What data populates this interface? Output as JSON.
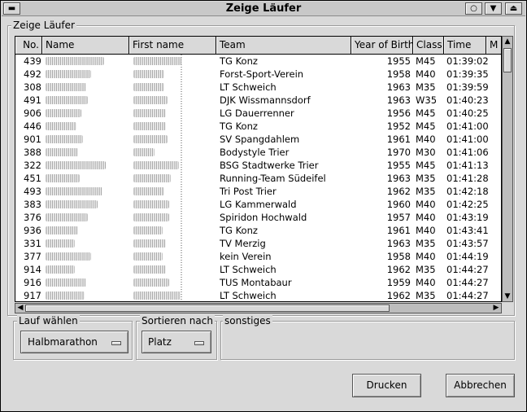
{
  "window": {
    "title": "Zeige Läufer",
    "controls": [
      "restore-icon",
      "minimize-icon",
      "maximize-icon"
    ]
  },
  "runners_group": {
    "legend": "Zeige Läufer"
  },
  "table": {
    "columns": [
      "No.",
      "Name",
      "First name",
      "Team",
      "Year of Birth",
      "Class",
      "Time",
      "M"
    ],
    "rows": [
      {
        "no": "439",
        "team": "TG Konz",
        "year": "1955",
        "class": "M45",
        "time": "01:39:02"
      },
      {
        "no": "492",
        "team": "Forst-Sport-Verein",
        "year": "1958",
        "class": "M40",
        "time": "01:39:35"
      },
      {
        "no": "308",
        "team": "LT Schweich",
        "year": "1963",
        "class": "M35",
        "time": "01:39:59"
      },
      {
        "no": "491",
        "team": "DJK Wissmannsdorf",
        "year": "1963",
        "class": "W35",
        "time": "01:40:23"
      },
      {
        "no": "906",
        "team": "LG Dauerrenner",
        "year": "1956",
        "class": "M45",
        "time": "01:40:25"
      },
      {
        "no": "446",
        "team": "TG Konz",
        "year": "1952",
        "class": "M45",
        "time": "01:41:00"
      },
      {
        "no": "901",
        "team": "SV Spangdahlem",
        "year": "1961",
        "class": "M40",
        "time": "01:41:00"
      },
      {
        "no": "388",
        "team": "Bodystyle Trier",
        "year": "1970",
        "class": "M30",
        "time": "01:41:06"
      },
      {
        "no": "322",
        "team": "BSG Stadtwerke Trier",
        "year": "1955",
        "class": "M45",
        "time": "01:41:13"
      },
      {
        "no": "451",
        "team": "Running-Team Südeifel",
        "year": "1963",
        "class": "M35",
        "time": "01:41:28"
      },
      {
        "no": "493",
        "team": "Tri Post Trier",
        "year": "1962",
        "class": "M35",
        "time": "01:42:18"
      },
      {
        "no": "383",
        "team": "LG Kammerwald",
        "year": "1960",
        "class": "M40",
        "time": "01:42:25"
      },
      {
        "no": "376",
        "team": "Spiridon Hochwald",
        "year": "1957",
        "class": "M40",
        "time": "01:43:19"
      },
      {
        "no": "936",
        "team": "TG Konz",
        "year": "1961",
        "class": "M40",
        "time": "01:43:41"
      },
      {
        "no": "331",
        "team": "TV Merzig",
        "year": "1963",
        "class": "M35",
        "time": "01:43:57"
      },
      {
        "no": "377",
        "team": "kein Verein",
        "year": "1958",
        "class": "M40",
        "time": "01:44:19"
      },
      {
        "no": "914",
        "team": "LT Schweich",
        "year": "1962",
        "class": "M35",
        "time": "01:44:27"
      },
      {
        "no": "916",
        "team": "TUS Montabaur",
        "year": "1959",
        "class": "M40",
        "time": "01:44:27"
      },
      {
        "no": "917",
        "team": "LT Schweich",
        "year": "1962",
        "class": "M35",
        "time": "01:44:27"
      }
    ]
  },
  "race_group": {
    "legend": "Lauf wählen",
    "selected": "Halbmarathon"
  },
  "sort_group": {
    "legend": "Sortieren nach",
    "selected": "Platz"
  },
  "misc_group": {
    "legend": "sonstiges"
  },
  "buttons": {
    "print": "Drucken",
    "cancel": "Abbrechen"
  }
}
